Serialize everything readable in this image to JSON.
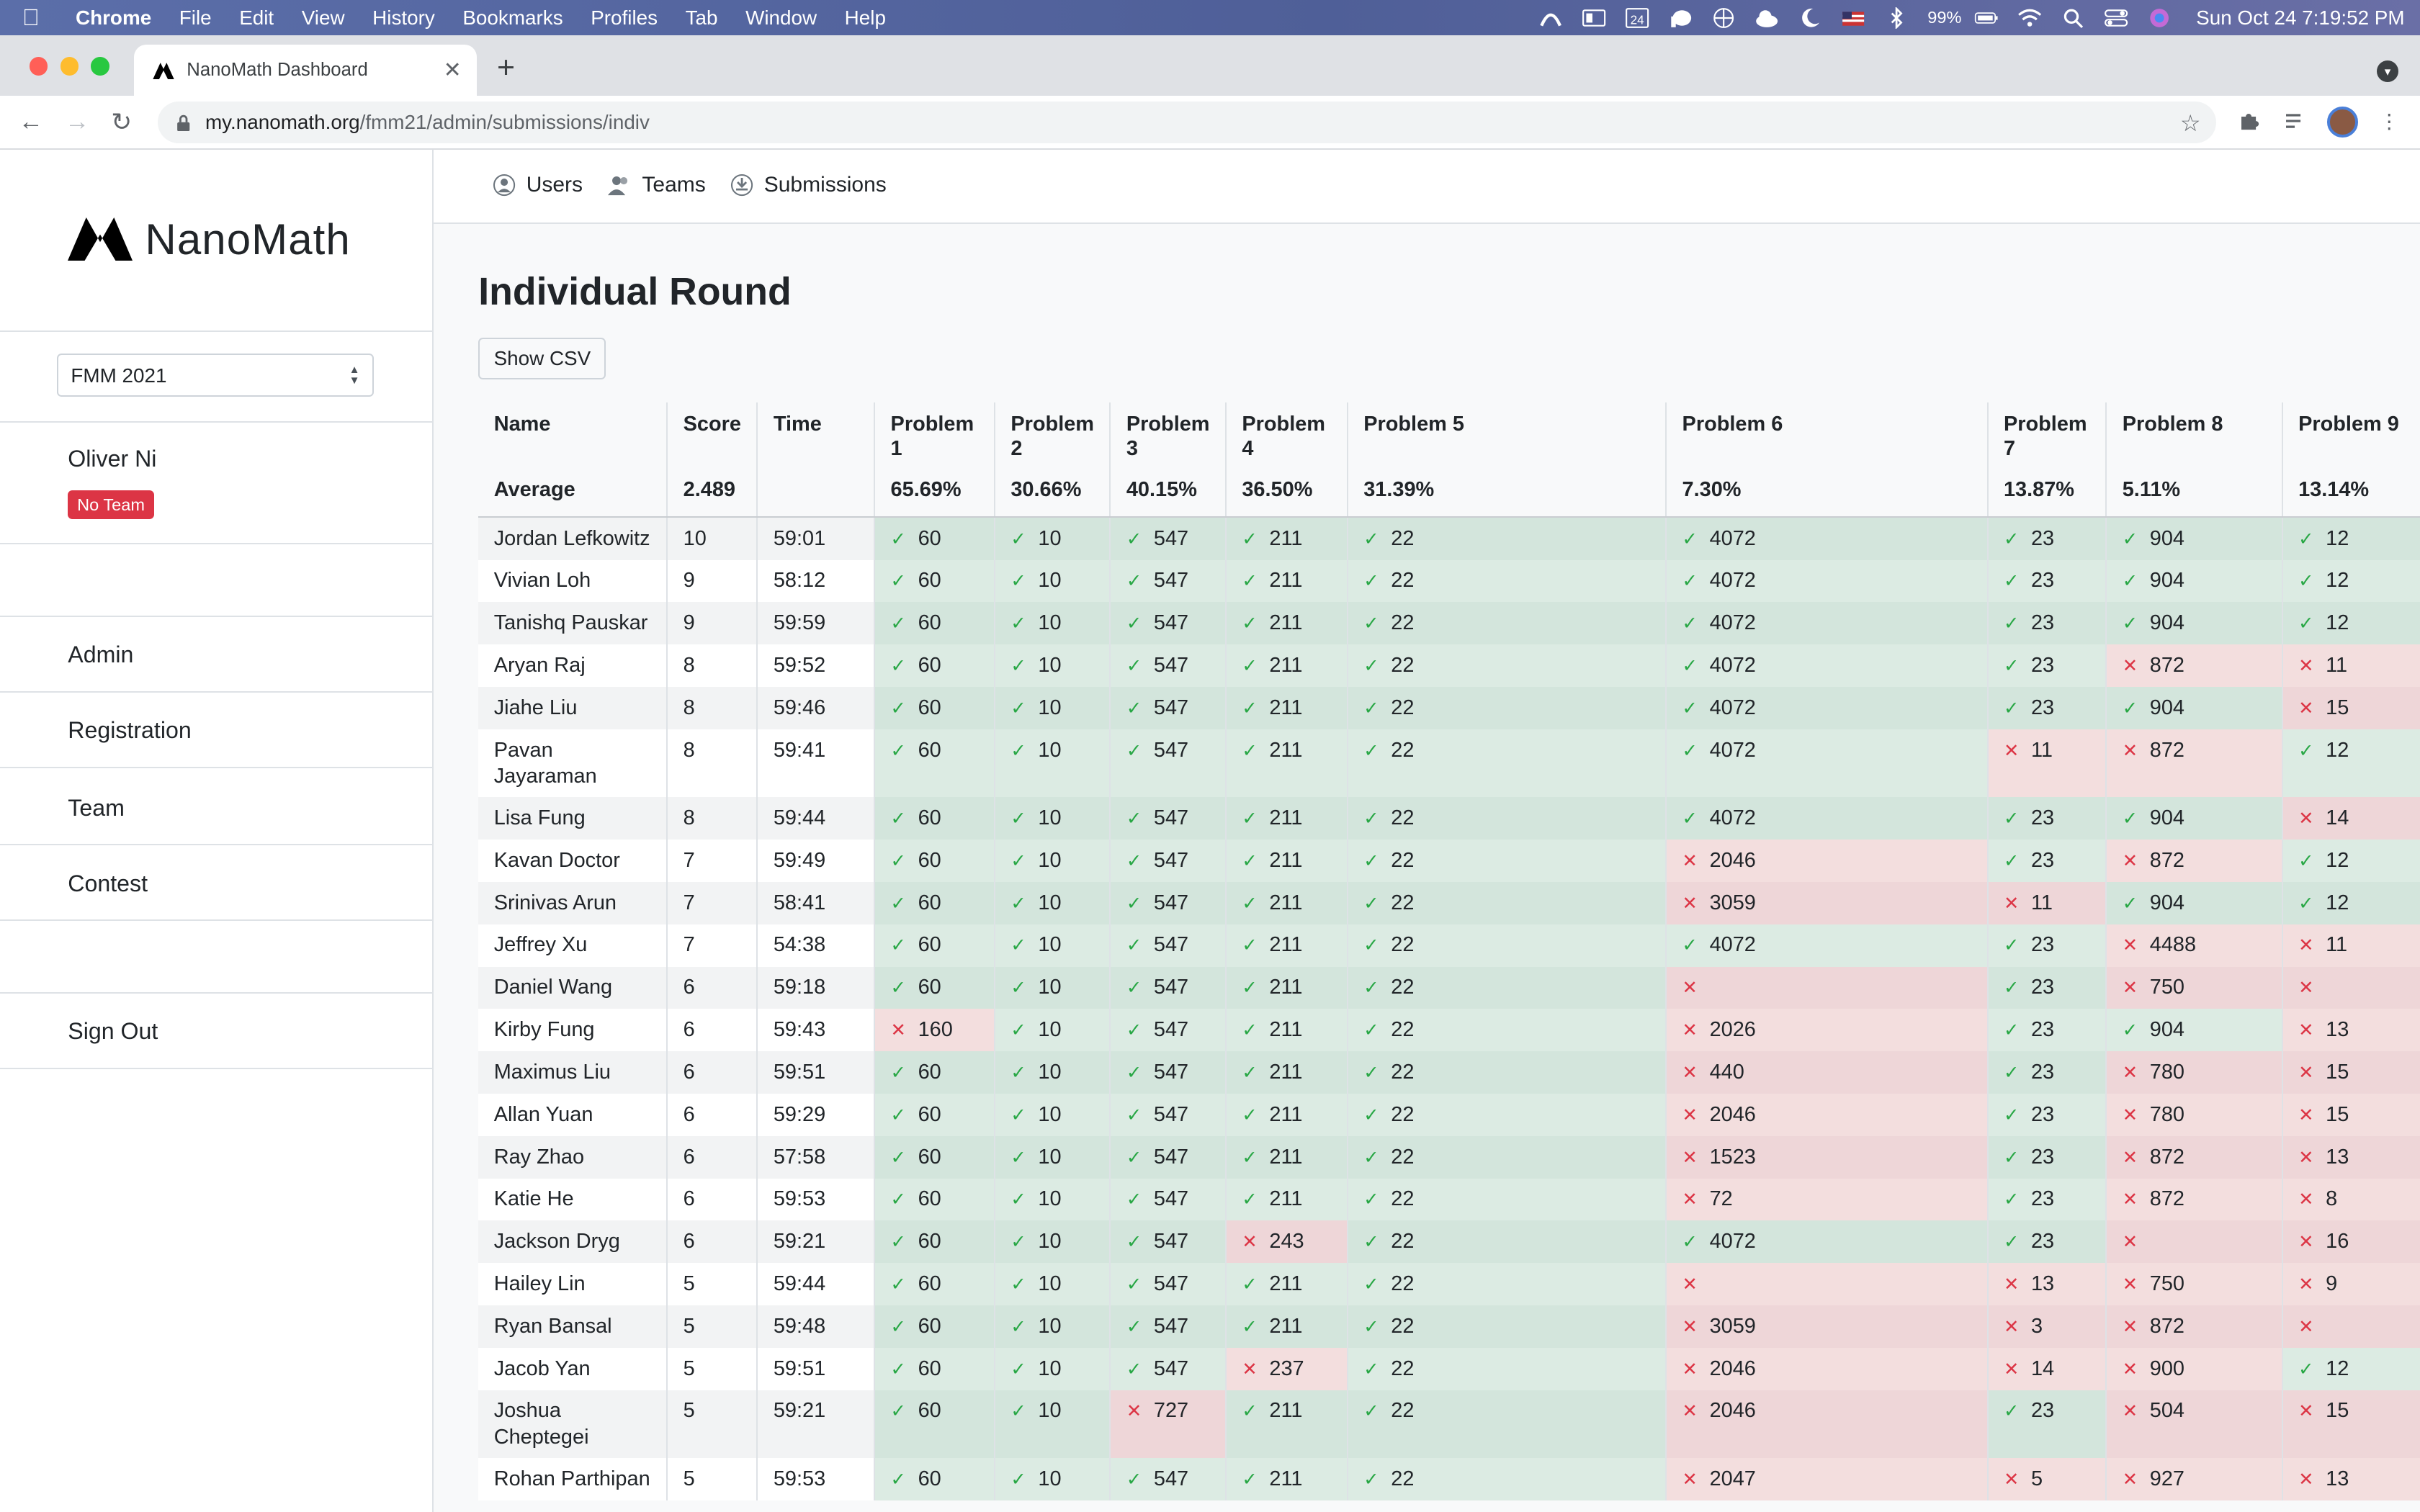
{
  "menubar": {
    "app": "Chrome",
    "items": [
      "File",
      "Edit",
      "View",
      "History",
      "Bookmarks",
      "Profiles",
      "Tab",
      "Window",
      "Help"
    ],
    "battery": "99%",
    "datetime": "Sun Oct 24  7:19:52 PM"
  },
  "browser": {
    "tab_title": "NanoMath Dashboard",
    "url_host": "my.nanomath.org",
    "url_path": "/fmm21/admin/submissions/indiv"
  },
  "sidebar": {
    "logo_text": "NanoMath",
    "contest_select": "FMM 2021",
    "user_name": "Oliver Ni",
    "team_badge": "No Team",
    "nav": [
      "Admin",
      "Registration",
      "Team",
      "Contest"
    ],
    "sign_out": "Sign Out"
  },
  "topnav": [
    "Users",
    "Teams",
    "Submissions"
  ],
  "main": {
    "title": "Individual Round",
    "csv_button": "Show CSV"
  },
  "colors": {
    "correct_bg": "#dcebe3",
    "incorrect_bg": "#f3dede",
    "badge": "#dc3545"
  },
  "table": {
    "headers": [
      "Name",
      "Score",
      "Time",
      "Problem 1",
      "Problem 2",
      "Problem 3",
      "Problem 4",
      "Problem 5",
      "Problem 6",
      "Problem 7",
      "Problem 8",
      "Problem 9"
    ],
    "average": [
      "Average",
      "2.489",
      "",
      "65.69%",
      "30.66%",
      "40.15%",
      "36.50%",
      "31.39%",
      "7.30%",
      "13.87%",
      "5.11%",
      "13.14%"
    ],
    "rows": [
      {
        "name": "Jordan Lefkowitz",
        "score": "10",
        "time": "59:01",
        "answers": [
          [
            1,
            "60"
          ],
          [
            1,
            "10"
          ],
          [
            1,
            "547"
          ],
          [
            1,
            "211"
          ],
          [
            1,
            "22"
          ],
          [
            1,
            "4072"
          ],
          [
            1,
            "23"
          ],
          [
            1,
            "904"
          ],
          [
            1,
            "12"
          ]
        ]
      },
      {
        "name": "Vivian Loh",
        "score": "9",
        "time": "58:12",
        "answers": [
          [
            1,
            "60"
          ],
          [
            1,
            "10"
          ],
          [
            1,
            "547"
          ],
          [
            1,
            "211"
          ],
          [
            1,
            "22"
          ],
          [
            1,
            "4072"
          ],
          [
            1,
            "23"
          ],
          [
            1,
            "904"
          ],
          [
            1,
            "12"
          ]
        ]
      },
      {
        "name": "Tanishq Pauskar",
        "score": "9",
        "time": "59:59",
        "answers": [
          [
            1,
            "60"
          ],
          [
            1,
            "10"
          ],
          [
            1,
            "547"
          ],
          [
            1,
            "211"
          ],
          [
            1,
            "22"
          ],
          [
            1,
            "4072"
          ],
          [
            1,
            "23"
          ],
          [
            1,
            "904"
          ],
          [
            1,
            "12"
          ]
        ]
      },
      {
        "name": "Aryan Raj",
        "score": "8",
        "time": "59:52",
        "answers": [
          [
            1,
            "60"
          ],
          [
            1,
            "10"
          ],
          [
            1,
            "547"
          ],
          [
            1,
            "211"
          ],
          [
            1,
            "22"
          ],
          [
            1,
            "4072"
          ],
          [
            1,
            "23"
          ],
          [
            0,
            "872"
          ],
          [
            0,
            "11"
          ]
        ]
      },
      {
        "name": "Jiahe Liu",
        "score": "8",
        "time": "59:46",
        "answers": [
          [
            1,
            "60"
          ],
          [
            1,
            "10"
          ],
          [
            1,
            "547"
          ],
          [
            1,
            "211"
          ],
          [
            1,
            "22"
          ],
          [
            1,
            "4072"
          ],
          [
            1,
            "23"
          ],
          [
            1,
            "904"
          ],
          [
            0,
            "15"
          ]
        ]
      },
      {
        "name": "Pavan Jayaraman",
        "score": "8",
        "time": "59:41",
        "answers": [
          [
            1,
            "60"
          ],
          [
            1,
            "10"
          ],
          [
            1,
            "547"
          ],
          [
            1,
            "211"
          ],
          [
            1,
            "22"
          ],
          [
            1,
            "4072"
          ],
          [
            0,
            "11"
          ],
          [
            0,
            "872"
          ],
          [
            1,
            "12"
          ]
        ]
      },
      {
        "name": "Lisa Fung",
        "score": "8",
        "time": "59:44",
        "answers": [
          [
            1,
            "60"
          ],
          [
            1,
            "10"
          ],
          [
            1,
            "547"
          ],
          [
            1,
            "211"
          ],
          [
            1,
            "22"
          ],
          [
            1,
            "4072"
          ],
          [
            1,
            "23"
          ],
          [
            1,
            "904"
          ],
          [
            0,
            "14"
          ]
        ]
      },
      {
        "name": "Kavan Doctor",
        "score": "7",
        "time": "59:49",
        "answers": [
          [
            1,
            "60"
          ],
          [
            1,
            "10"
          ],
          [
            1,
            "547"
          ],
          [
            1,
            "211"
          ],
          [
            1,
            "22"
          ],
          [
            0,
            "2046"
          ],
          [
            1,
            "23"
          ],
          [
            0,
            "872"
          ],
          [
            1,
            "12"
          ]
        ]
      },
      {
        "name": "Srinivas Arun",
        "score": "7",
        "time": "58:41",
        "answers": [
          [
            1,
            "60"
          ],
          [
            1,
            "10"
          ],
          [
            1,
            "547"
          ],
          [
            1,
            "211"
          ],
          [
            1,
            "22"
          ],
          [
            0,
            "3059"
          ],
          [
            0,
            "11"
          ],
          [
            1,
            "904"
          ],
          [
            1,
            "12"
          ]
        ]
      },
      {
        "name": "Jeffrey Xu",
        "score": "7",
        "time": "54:38",
        "answers": [
          [
            1,
            "60"
          ],
          [
            1,
            "10"
          ],
          [
            1,
            "547"
          ],
          [
            1,
            "211"
          ],
          [
            1,
            "22"
          ],
          [
            1,
            "4072"
          ],
          [
            1,
            "23"
          ],
          [
            0,
            "4488"
          ],
          [
            0,
            "11"
          ]
        ]
      },
      {
        "name": "Daniel Wang",
        "score": "6",
        "time": "59:18",
        "answers": [
          [
            1,
            "60"
          ],
          [
            1,
            "10"
          ],
          [
            1,
            "547"
          ],
          [
            1,
            "211"
          ],
          [
            1,
            "22"
          ],
          [
            0,
            ""
          ],
          [
            1,
            "23"
          ],
          [
            0,
            "750"
          ],
          [
            0,
            ""
          ]
        ]
      },
      {
        "name": "Kirby Fung",
        "score": "6",
        "time": "59:43",
        "answers": [
          [
            0,
            "160"
          ],
          [
            1,
            "10"
          ],
          [
            1,
            "547"
          ],
          [
            1,
            "211"
          ],
          [
            1,
            "22"
          ],
          [
            0,
            "2026"
          ],
          [
            1,
            "23"
          ],
          [
            1,
            "904"
          ],
          [
            0,
            "13"
          ]
        ]
      },
      {
        "name": "Maximus Liu",
        "score": "6",
        "time": "59:51",
        "answers": [
          [
            1,
            "60"
          ],
          [
            1,
            "10"
          ],
          [
            1,
            "547"
          ],
          [
            1,
            "211"
          ],
          [
            1,
            "22"
          ],
          [
            0,
            "440"
          ],
          [
            1,
            "23"
          ],
          [
            0,
            "780"
          ],
          [
            0,
            "15"
          ]
        ]
      },
      {
        "name": "Allan Yuan",
        "score": "6",
        "time": "59:29",
        "answers": [
          [
            1,
            "60"
          ],
          [
            1,
            "10"
          ],
          [
            1,
            "547"
          ],
          [
            1,
            "211"
          ],
          [
            1,
            "22"
          ],
          [
            0,
            "2046"
          ],
          [
            1,
            "23"
          ],
          [
            0,
            "780"
          ],
          [
            0,
            "15"
          ]
        ]
      },
      {
        "name": "Ray Zhao",
        "score": "6",
        "time": "57:58",
        "answers": [
          [
            1,
            "60"
          ],
          [
            1,
            "10"
          ],
          [
            1,
            "547"
          ],
          [
            1,
            "211"
          ],
          [
            1,
            "22"
          ],
          [
            0,
            "1523"
          ],
          [
            1,
            "23"
          ],
          [
            0,
            "872"
          ],
          [
            0,
            "13"
          ]
        ]
      },
      {
        "name": "Katie He",
        "score": "6",
        "time": "59:53",
        "answers": [
          [
            1,
            "60"
          ],
          [
            1,
            "10"
          ],
          [
            1,
            "547"
          ],
          [
            1,
            "211"
          ],
          [
            1,
            "22"
          ],
          [
            0,
            "72"
          ],
          [
            1,
            "23"
          ],
          [
            0,
            "872"
          ],
          [
            0,
            "8"
          ]
        ]
      },
      {
        "name": "Jackson Dryg",
        "score": "6",
        "time": "59:21",
        "answers": [
          [
            1,
            "60"
          ],
          [
            1,
            "10"
          ],
          [
            1,
            "547"
          ],
          [
            0,
            "243"
          ],
          [
            1,
            "22"
          ],
          [
            1,
            "4072"
          ],
          [
            1,
            "23"
          ],
          [
            0,
            ""
          ],
          [
            0,
            "16"
          ]
        ]
      },
      {
        "name": "Hailey Lin",
        "score": "5",
        "time": "59:44",
        "answers": [
          [
            1,
            "60"
          ],
          [
            1,
            "10"
          ],
          [
            1,
            "547"
          ],
          [
            1,
            "211"
          ],
          [
            1,
            "22"
          ],
          [
            0,
            ""
          ],
          [
            0,
            "13"
          ],
          [
            0,
            "750"
          ],
          [
            0,
            "9"
          ]
        ]
      },
      {
        "name": "Ryan Bansal",
        "score": "5",
        "time": "59:48",
        "answers": [
          [
            1,
            "60"
          ],
          [
            1,
            "10"
          ],
          [
            1,
            "547"
          ],
          [
            1,
            "211"
          ],
          [
            1,
            "22"
          ],
          [
            0,
            "3059"
          ],
          [
            0,
            "3"
          ],
          [
            0,
            "872"
          ],
          [
            0,
            ""
          ]
        ]
      },
      {
        "name": "Jacob Yan",
        "score": "5",
        "time": "59:51",
        "answers": [
          [
            1,
            "60"
          ],
          [
            1,
            "10"
          ],
          [
            1,
            "547"
          ],
          [
            0,
            "237"
          ],
          [
            1,
            "22"
          ],
          [
            0,
            "2046"
          ],
          [
            0,
            "14"
          ],
          [
            0,
            "900"
          ],
          [
            1,
            "12"
          ]
        ]
      },
      {
        "name": "Joshua Cheptegei",
        "score": "5",
        "time": "59:21",
        "answers": [
          [
            1,
            "60"
          ],
          [
            1,
            "10"
          ],
          [
            0,
            "727"
          ],
          [
            1,
            "211"
          ],
          [
            1,
            "22"
          ],
          [
            0,
            "2046"
          ],
          [
            1,
            "23"
          ],
          [
            0,
            "504"
          ],
          [
            0,
            "15"
          ]
        ]
      },
      {
        "name": "Rohan Parthipan",
        "score": "5",
        "time": "59:53",
        "answers": [
          [
            1,
            "60"
          ],
          [
            1,
            "10"
          ],
          [
            1,
            "547"
          ],
          [
            1,
            "211"
          ],
          [
            1,
            "22"
          ],
          [
            0,
            "2047"
          ],
          [
            0,
            "5"
          ],
          [
            0,
            "927"
          ],
          [
            0,
            "13"
          ]
        ]
      }
    ]
  }
}
